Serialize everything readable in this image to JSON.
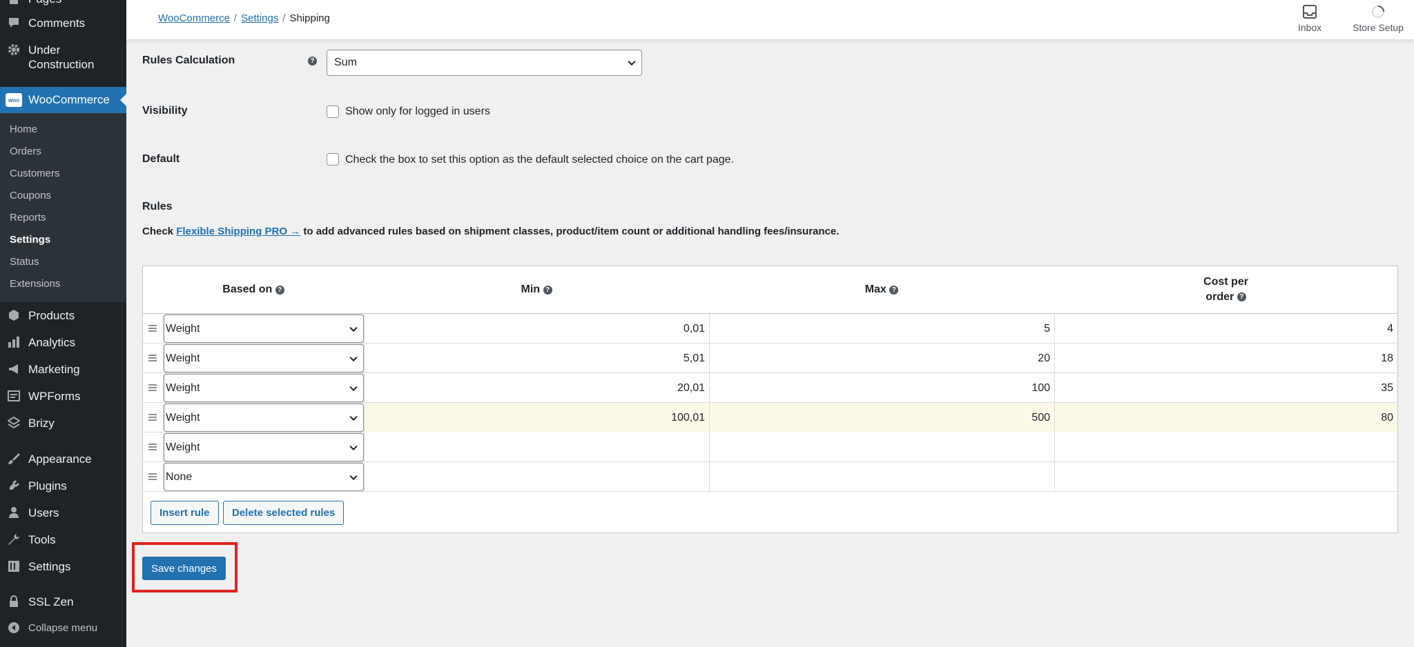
{
  "sidebar": {
    "items": [
      {
        "label": "Pages",
        "icon": "pages-icon"
      },
      {
        "label": "Comments",
        "icon": "comment-icon"
      },
      {
        "label": "Under Construction",
        "icon": "gear-icon"
      },
      {
        "label": "WooCommerce",
        "icon": "woocommerce-icon"
      },
      {
        "label": "Products",
        "icon": "box-icon"
      },
      {
        "label": "Analytics",
        "icon": "bar-chart-icon"
      },
      {
        "label": "Marketing",
        "icon": "megaphone-icon"
      },
      {
        "label": "WPForms",
        "icon": "form-icon"
      },
      {
        "label": "Brizy",
        "icon": "brizy-icon"
      },
      {
        "label": "Appearance",
        "icon": "paintbrush-icon"
      },
      {
        "label": "Plugins",
        "icon": "plug-icon"
      },
      {
        "label": "Users",
        "icon": "user-icon"
      },
      {
        "label": "Tools",
        "icon": "wrench-icon"
      },
      {
        "label": "Settings",
        "icon": "settings-icon"
      },
      {
        "label": "SSL Zen",
        "icon": "lock-icon"
      },
      {
        "label": "Collapse menu",
        "icon": "collapse-icon"
      }
    ],
    "woo_icon_text": "woo",
    "submenu": [
      "Home",
      "Orders",
      "Customers",
      "Coupons",
      "Reports",
      "Settings",
      "Status",
      "Extensions"
    ],
    "submenu_current": "Settings"
  },
  "topbar": {
    "breadcrumb": [
      "WooCommerce",
      "Settings",
      "Shipping"
    ],
    "actions": [
      {
        "label": "Inbox",
        "icon": "inbox-icon"
      },
      {
        "label": "Store Setup",
        "icon": "progress-ring-icon"
      }
    ]
  },
  "form": {
    "rules_calculation": {
      "label": "Rules Calculation",
      "value": "Sum"
    },
    "visibility": {
      "label": "Visibility",
      "checkbox_text": "Show only for logged in users",
      "checked": false
    },
    "default": {
      "label": "Default",
      "checkbox_text": "Check the box to set this option as the default selected choice on the cart page.",
      "checked": false
    },
    "rules_heading": "Rules",
    "note_prefix": "Check",
    "note_link": "Flexible Shipping PRO →",
    "note_suffix": "to add advanced rules based on shipment classes, product/item count or additional handling fees/insurance."
  },
  "table": {
    "headers": {
      "based_on": "Based on",
      "min": "Min",
      "max": "Max",
      "cost_line1": "Cost per",
      "cost_line2": "order"
    },
    "rows": [
      {
        "based_on": "Weight",
        "min": "0,01",
        "max": "5",
        "cost": "4"
      },
      {
        "based_on": "Weight",
        "min": "5,01",
        "max": "20",
        "cost": "18"
      },
      {
        "based_on": "Weight",
        "min": "20,01",
        "max": "100",
        "cost": "35"
      },
      {
        "based_on": "Weight",
        "min": "100,01",
        "max": "500",
        "cost": "80"
      },
      {
        "based_on": "Weight",
        "min": "",
        "max": "",
        "cost": ""
      },
      {
        "based_on": "None",
        "min": "",
        "max": "",
        "cost": ""
      }
    ],
    "insert_label": "Insert rule",
    "delete_label": "Delete selected rules"
  },
  "save_label": "Save changes",
  "colors": {
    "accent": "#2271b1",
    "sidebar": "#1d2327",
    "highlight_border": "#e0211c",
    "row_highlight": "#fcf9e8"
  }
}
